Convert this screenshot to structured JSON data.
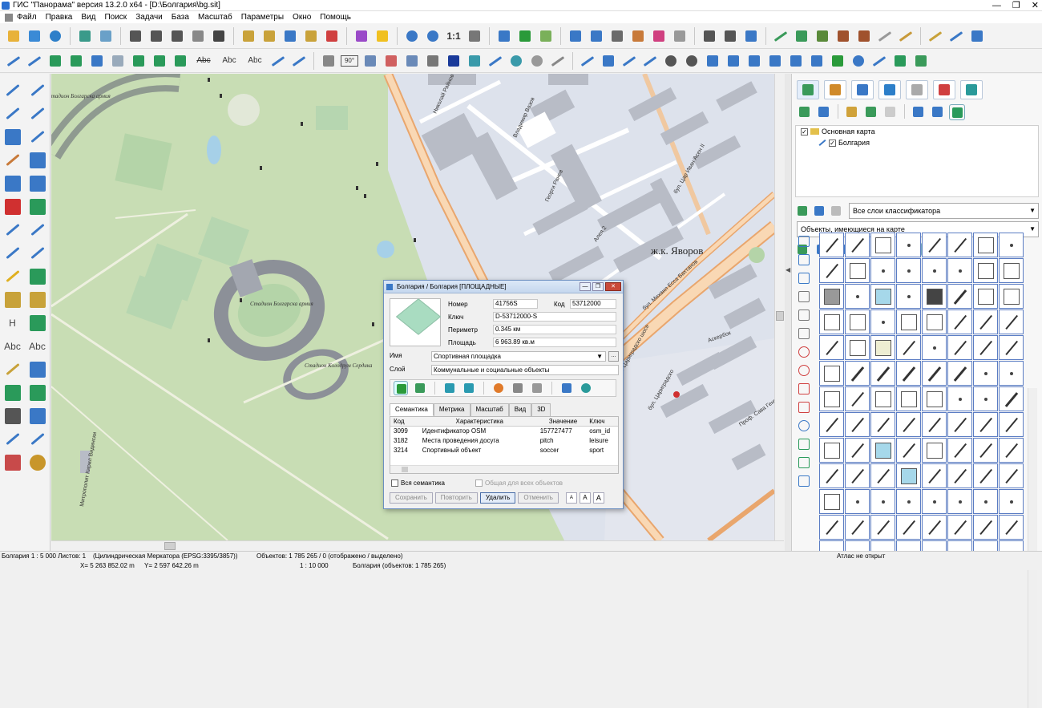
{
  "window": {
    "title": "ГИС \"Панорама\" версия 13.2.0 x64 - [D:\\Болгария\\bg.sit]",
    "controls": [
      "—",
      "❐",
      "✕"
    ]
  },
  "menu": [
    "Файл",
    "Правка",
    "Вид",
    "Поиск",
    "Задачи",
    "База",
    "Масштаб",
    "Параметры",
    "Окно",
    "Помощь"
  ],
  "toolbar": {
    "scale_one_label": "1:1",
    "text_labels": [
      "Abc",
      "Abc",
      "Abc"
    ],
    "box_label": "90°"
  },
  "left_tools": {
    "text_labels": [
      "H",
      "Abc",
      "Abc"
    ]
  },
  "map": {
    "labels": [
      "ж.к. Яворов",
      "Стадион Болгарска армия",
      "Стадион Болгарска армия",
      "Стадион Колодрум Сердика",
      "бул. Цариградско шосе",
      "бул. Цар Иван Асен II",
      "бул. Михаил Ecca Бахтанов",
      "бул. Цариградско",
      "Проф. Сава Генов",
      "Алея 2",
      "Владимир Вазов",
      "Николай Райнов",
      "Георги Ранев",
      "Митрополит Кирил Видински",
      "Аскербок"
    ]
  },
  "right_panel": {
    "tabs": [
      "map-tab",
      "layers-tab",
      "objects-tab",
      "globe-tab",
      "doc-tab",
      "legend-tab",
      "exit-tab"
    ],
    "tree": [
      {
        "label": "Основная карта",
        "checked": true
      },
      {
        "label": "Болгария",
        "checked": true
      }
    ],
    "select_layers": "Все слои классификатора",
    "select_objects": "Объекты, имеющиеся на карте"
  },
  "dialog": {
    "title": "Болгария / Болгария [ПЛОЩАДНЫЕ]",
    "fields": {
      "number_label": "Номер",
      "number_value": "41756S",
      "code_label": "Код",
      "code_value": "53712000",
      "key_label": "Ключ",
      "key_value": "D-53712000-S",
      "perimeter_label": "Периметр",
      "perimeter_value": "0.345 км",
      "area_label": "Площадь",
      "area_value": "6 963.89 кв.м"
    },
    "name_label": "Имя",
    "name_value": "Спортивная площадка",
    "ellipsis": "...",
    "layer_label": "Слой",
    "layer_value": "Коммунальные и социальные объекты",
    "tabs": [
      "Семантика",
      "Метрика",
      "Масштаб",
      "Вид",
      "3D"
    ],
    "table": {
      "headers": [
        "Код",
        "Характеристика",
        "Значение",
        "Ключ"
      ],
      "rows": [
        [
          "3099",
          "Идентификатор OSM",
          "157727477",
          "osm_id"
        ],
        [
          "3182",
          "Места проведения досуга",
          "pitch",
          "leisure"
        ],
        [
          "3214",
          "Спортивный объект",
          "soccer",
          "sport"
        ]
      ]
    },
    "check_all": "Вся семантика",
    "check_common": "Общая для всех объектов",
    "buttons": [
      "Сохранить",
      "Повторить",
      "Удалить",
      "Отменить"
    ],
    "font_buttons": [
      "A",
      "A",
      "A"
    ]
  },
  "status": {
    "scale": "Болгария  1 : 5 000  Листов: 1",
    "projection": "(Цилиндрическая Меркатора (EPSG:3395/3857))",
    "objects": "Объектов: 1 785 265 / 0 (отображено / выделено)",
    "atlas": "Атлас не открыт",
    "coords_x": "X= 5 263 852.02 m",
    "coords_y": "Y= 2 597 642.26 m",
    "scale2": "1 : 10 000",
    "objects2": "Болгария  (объектов: 1 785 265)"
  },
  "colors": {
    "park": "#c8ddb4",
    "block": "#dde2ec",
    "building": "#b8bcc6",
    "road": "#f5c89a",
    "accent": "#6c8fc0"
  }
}
